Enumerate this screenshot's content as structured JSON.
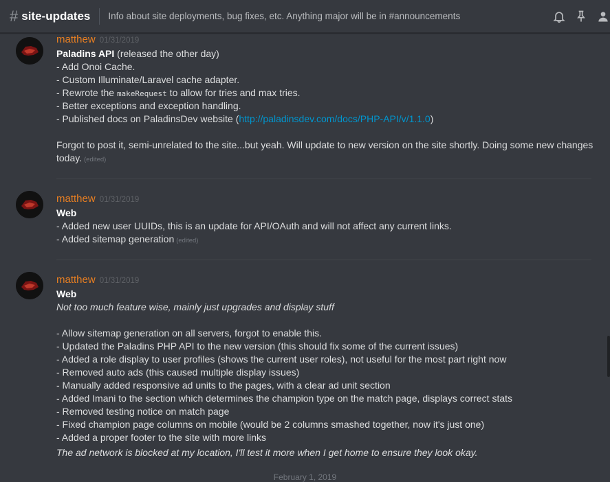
{
  "header": {
    "hash": "#",
    "channel": "site-updates",
    "topic": "Info about site deployments, bug fixes, etc. Anything major will be in #announcements",
    "icons": [
      "bell-icon",
      "pin-icon",
      "members-icon"
    ]
  },
  "messages": [
    {
      "author": "matthew",
      "timestamp": "01/31/2019",
      "title": "Paladins API",
      "title_suffix": " (released the other day)",
      "lines": [
        "- Add Onoi Cache.",
        "- Custom Illuminate/Laravel cache adapter.",
        "- Rewrote the ",
        "makeRequest",
        " to allow for tries and max tries.",
        "- Better exceptions and exception handling.",
        "- Published docs on PaladinsDev website (",
        "http://paladinsdev.com/docs/PHP-API/v/1.1.0",
        ")",
        "Forgot to post it, semi-unrelated to the site...but yeah. Will update to new version on the site shortly. Doing some new changes",
        "today."
      ],
      "edited": "(edited)"
    },
    {
      "author": "matthew",
      "timestamp": "01/31/2019",
      "title": "Web",
      "lines": [
        "- Added new user UUIDs, this is an update for API/OAuth and will not affect any current links.",
        "- Added sitemap generation"
      ],
      "edited": "(edited)"
    },
    {
      "author": "matthew",
      "timestamp": "01/31/2019",
      "title": "Web",
      "intro": "Not too much feature wise, mainly just upgrades and display stuff",
      "lines": [
        "- Allow sitemap generation on all servers, forgot to enable this.",
        "- Updated the Paladins PHP API to the new version (this should fix some of the current issues)",
        "- Added a role display to user profiles (shows the current user roles), not useful for the most part right now",
        "- Removed auto ads (this caused multiple display issues)",
        "- Manually added responsive ad units to the pages, with a clear ad unit section",
        "- Added Imani to the section which determines the champion type on the match page, displays correct stats",
        "- Removed testing notice on match page",
        "- Fixed champion page columns on mobile (would be 2 columns smashed together,  now it's just one)",
        "- Added a proper footer to the site with more links"
      ],
      "outro": "The ad network is blocked at my location, I'll test it more when I get home to ensure they look okay."
    }
  ],
  "date_separator": "February 1, 2019"
}
